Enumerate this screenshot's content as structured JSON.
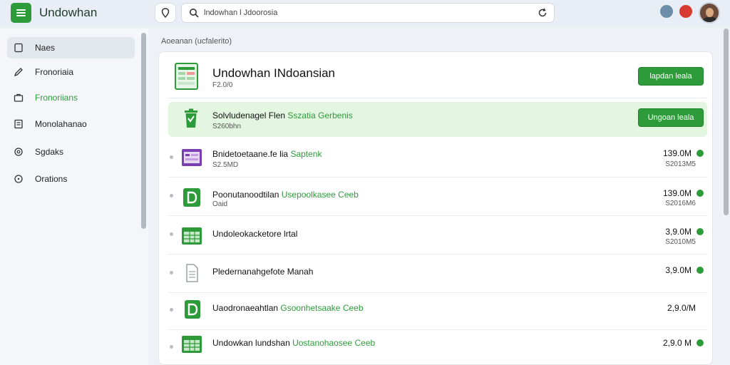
{
  "header": {
    "app_title": "Undowhan",
    "search_text": "lndowhan l Jdoorosia"
  },
  "sidebar": {
    "items": [
      {
        "label": "Naes",
        "icon": "document-icon",
        "active": true
      },
      {
        "label": "Fronoriaia",
        "icon": "pen-icon"
      },
      {
        "label": "Fronoriians",
        "icon": "briefcase-icon",
        "green": true
      },
      {
        "label": "Monolahanao",
        "icon": "receipt-icon"
      },
      {
        "label": "Sgdaks",
        "icon": "settings-icon"
      },
      {
        "label": "Orations",
        "icon": "info-icon"
      }
    ]
  },
  "main": {
    "breadcrumb": "Aoeanan (ucfalerito)",
    "top": {
      "title": "Undowhan INdoansian",
      "subtitle": "F2.0/0",
      "button": "lapdan leala"
    },
    "highlight": {
      "title": "Solvludenagel Flen",
      "title_green": "Sszatia Gerbenis",
      "subtitle": "S260bhn",
      "button": "Ungoan leala"
    },
    "rows": [
      {
        "title": "Bnidetoetaane.fe lia",
        "title_green": "Saptenk",
        "sub": "S2.5MD",
        "value": "139.0M",
        "value_sub": "S2013M5",
        "icon": "purple-sheet-icon"
      },
      {
        "title": "Poonutanoodtilan",
        "title_green": "Usepoolkasee Ceeb",
        "sub": "Oaid",
        "value": "139.0M",
        "value_sub": "S2016M6",
        "icon": "green-d-icon"
      },
      {
        "title": "Undoleokacketore lrtal",
        "title_green": "",
        "sub": "",
        "value": "3,9.0M",
        "value_sub": "S2010M5",
        "icon": "green-sheet-icon"
      },
      {
        "title": "Pledernanahgefote Manah",
        "title_green": "",
        "sub": "",
        "value": "3,9.0M",
        "value_sub": "",
        "icon": "doc-icon"
      },
      {
        "title": "Uaodronaeahtlan",
        "title_green": "Gsoonhetsaake Ceeb",
        "sub": "",
        "value": "2,9.0/M",
        "value_sub": "",
        "icon": "green-d-icon"
      },
      {
        "title": "Undowkan lundshan",
        "title_green": "Uostanohaosee Ceeb",
        "sub": "",
        "value": "2,9.0 M",
        "value_sub": "",
        "icon": "green-sheet-icon"
      }
    ]
  },
  "colors": {
    "accent": "#2e9b3a",
    "highlight_bg": "#e2f6e0"
  }
}
